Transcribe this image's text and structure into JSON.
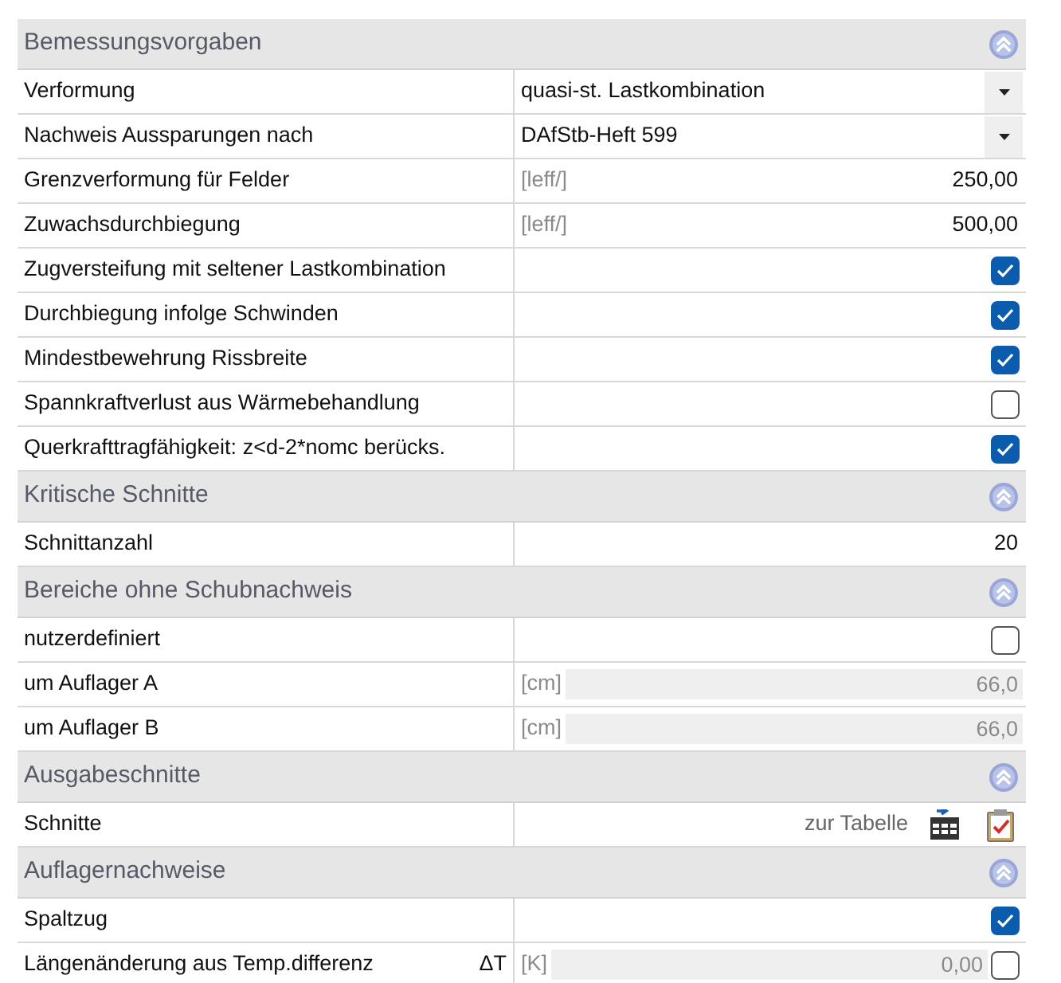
{
  "sections": [
    {
      "title": "Bemessungsvorgaben",
      "expanded": true,
      "rows": [
        {
          "kind": "dropdown",
          "label": "Verformung",
          "value": "quasi-st. Lastkombination"
        },
        {
          "kind": "dropdown",
          "label": "Nachweis Aussparungen nach",
          "value": "DAfStb-Heft 599"
        },
        {
          "kind": "number",
          "label": "Grenzverformung für Felder",
          "unit": "[leff/]",
          "value": "250,00"
        },
        {
          "kind": "number",
          "label": "Zuwachsdurchbiegung",
          "unit": "[leff/]",
          "value": "500,00"
        },
        {
          "kind": "checkbox",
          "label": "Zugversteifung mit seltener Lastkombination",
          "checked": true
        },
        {
          "kind": "checkbox",
          "label": "Durchbiegung infolge Schwinden",
          "checked": true
        },
        {
          "kind": "checkbox",
          "label": "Mindestbewehrung Rissbreite",
          "checked": true
        },
        {
          "kind": "checkbox",
          "label": "Spannkraftverlust aus Wärmebehandlung",
          "checked": false
        },
        {
          "kind": "checkbox",
          "label": "Querkrafttragfähigkeit: z<d-2*nomc berücks.",
          "checked": true
        }
      ]
    },
    {
      "title": "Kritische Schnitte",
      "expanded": true,
      "rows": [
        {
          "kind": "number",
          "label": "Schnittanzahl",
          "value": "20"
        }
      ]
    },
    {
      "title": "Bereiche ohne Schubnachweis",
      "expanded": true,
      "rows": [
        {
          "kind": "checkbox",
          "label": "nutzerdefiniert",
          "checked": false
        },
        {
          "kind": "number",
          "label": "um Auflager A",
          "unit": "[cm]",
          "value": "66,0",
          "disabled": true
        },
        {
          "kind": "number",
          "label": "um Auflager B",
          "unit": "[cm]",
          "value": "66,0",
          "disabled": true
        }
      ]
    },
    {
      "title": "Ausgabeschnitte",
      "expanded": true,
      "rows": [
        {
          "kind": "link",
          "label": "Schnitte",
          "value": "zur Tabelle"
        }
      ]
    },
    {
      "title": "Auflagernachweise",
      "expanded": true,
      "rows": [
        {
          "kind": "checkbox",
          "label": "Spaltzug",
          "checked": true
        },
        {
          "kind": "number",
          "label": "Längenänderung aus Temp.differenz",
          "symbol": "ΔT",
          "unit": "[K]",
          "value": "0,00",
          "disabled": true,
          "checked": false
        }
      ]
    }
  ]
}
